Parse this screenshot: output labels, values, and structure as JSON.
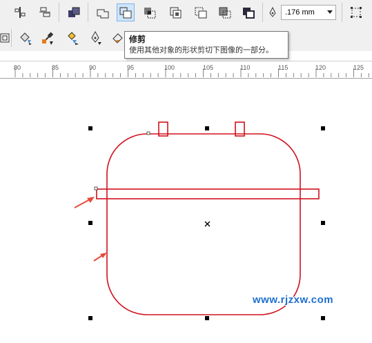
{
  "toolbar": {
    "outline_width_value": ".176 mm",
    "dropdown_arrow": "▼"
  },
  "tooltip": {
    "title": "修剪",
    "description": "使用其他对象的形状剪切下图像的一部分。"
  },
  "ruler": {
    "labels": [
      "80",
      "85",
      "90",
      "95",
      "100",
      "105",
      "110",
      "115",
      "120",
      "125"
    ]
  },
  "watermark": {
    "text": "www.rjzxw.com"
  },
  "colors": {
    "shape_outline": "#d0101c",
    "arrow": "#e84a3a",
    "active_button": "#cfe5fa",
    "watermark": "#1e6fd0"
  },
  "icons": [
    "align-distribute-icon",
    "align-objects-icon",
    "combine-icon",
    "weld-icon",
    "trim-icon",
    "intersect-icon",
    "simplify-icon",
    "front-minus-back-icon",
    "back-minus-front-icon",
    "create-boundary-icon",
    "outline-pen-icon",
    "convert-to-curves-icon",
    "fill-tool-icon",
    "interactive-fill-icon",
    "eyedropper-icon",
    "attributes-eyedropper-icon",
    "outline-pen-tool-icon",
    "contour-tool-icon"
  ]
}
